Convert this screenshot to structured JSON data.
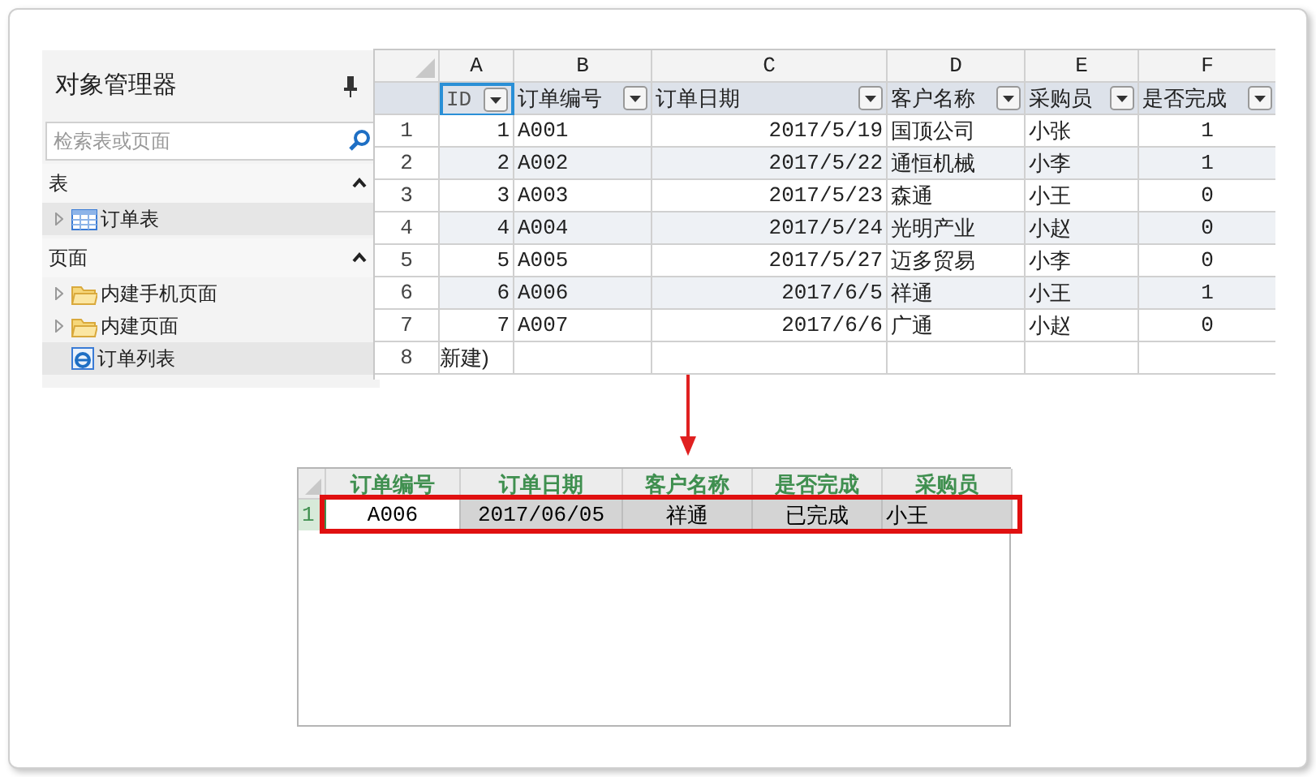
{
  "object_manager": {
    "title": "对象管理器",
    "search": {
      "placeholder": "检索表或页面"
    },
    "sections": [
      {
        "title": "表",
        "expanded": true,
        "items": [
          {
            "label": "订单表",
            "kind": "table",
            "selected": true
          }
        ]
      },
      {
        "title": "页面",
        "expanded": true,
        "items": [
          {
            "label": "内建手机页面",
            "kind": "folder",
            "selected": false
          },
          {
            "label": "内建页面",
            "kind": "folder",
            "selected": false
          },
          {
            "label": "订单列表",
            "kind": "page",
            "selected": true
          }
        ]
      }
    ]
  },
  "sheet": {
    "column_letters": [
      "A",
      "B",
      "C",
      "D",
      "E",
      "F"
    ],
    "fields": [
      {
        "label": "ID",
        "selected": true
      },
      {
        "label": "订单编号",
        "selected": false
      },
      {
        "label": "订单日期",
        "selected": false
      },
      {
        "label": "客户名称",
        "selected": false
      },
      {
        "label": "采购员",
        "selected": false
      },
      {
        "label": "是否完成",
        "selected": false
      }
    ],
    "rows": [
      {
        "number": "1",
        "cells": [
          "1",
          "A001",
          "2017/5/19",
          "国顶公司",
          "小张",
          "1"
        ]
      },
      {
        "number": "2",
        "cells": [
          "2",
          "A002",
          "2017/5/22",
          "通恒机械",
          "小李",
          "1"
        ]
      },
      {
        "number": "3",
        "cells": [
          "3",
          "A003",
          "2017/5/23",
          "森通",
          "小王",
          "0"
        ]
      },
      {
        "number": "4",
        "cells": [
          "4",
          "A004",
          "2017/5/24",
          "光明产业",
          "小赵",
          "0"
        ]
      },
      {
        "number": "5",
        "cells": [
          "5",
          "A005",
          "2017/5/27",
          "迈多贸易",
          "小李",
          "0"
        ]
      },
      {
        "number": "6",
        "cells": [
          "6",
          "A006",
          "2017/6/5",
          "祥通",
          "小王",
          "1"
        ]
      },
      {
        "number": "7",
        "cells": [
          "7",
          "A007",
          "2017/6/6",
          "广通",
          "小赵",
          "0"
        ]
      }
    ],
    "new_row": {
      "number": "8",
      "label": "新建)"
    }
  },
  "result": {
    "columns": [
      "订单编号",
      "订单日期",
      "客户名称",
      "是否完成",
      "采购员"
    ],
    "rows": [
      {
        "number": "1",
        "highlighted": true,
        "cells": [
          "A006",
          "2017/06/05",
          "祥通",
          "已完成",
          "小王"
        ]
      }
    ]
  }
}
